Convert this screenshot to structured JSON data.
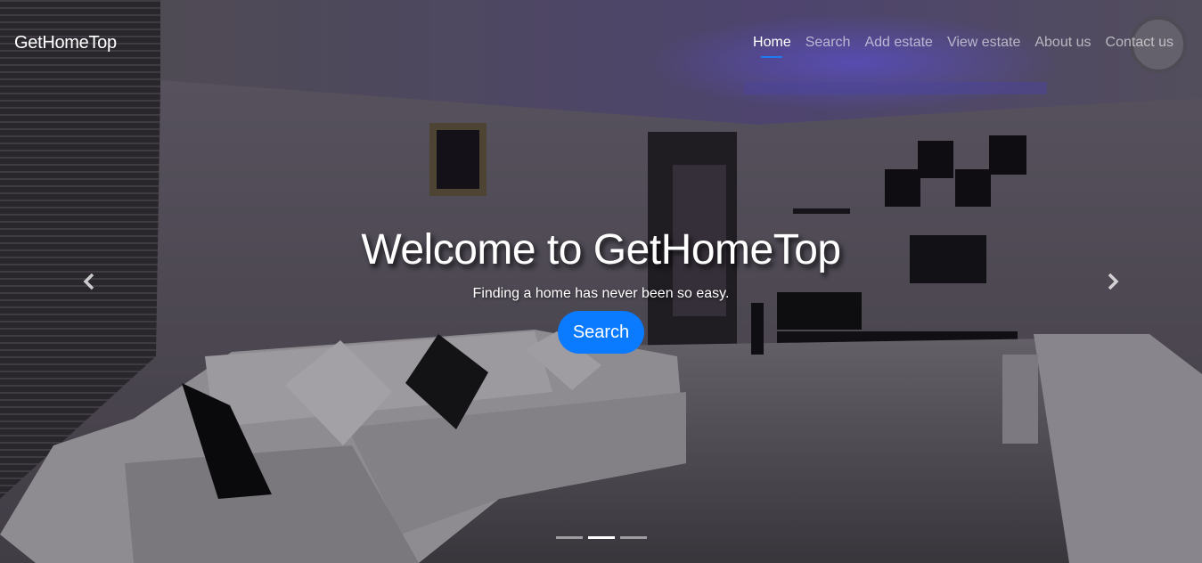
{
  "brand": "GetHomeTop",
  "nav": {
    "items": [
      {
        "label": "Home",
        "active": true
      },
      {
        "label": "Search",
        "active": false
      },
      {
        "label": "Add estate",
        "active": false
      },
      {
        "label": "View estate",
        "active": false
      },
      {
        "label": "About us",
        "active": false
      },
      {
        "label": "Contact us",
        "active": false
      }
    ]
  },
  "hero": {
    "headline": "Welcome to GetHomeTop",
    "subline": "Finding a home has never been so easy.",
    "cta_label": "Search",
    "background_image": "living-room-interior-photo"
  },
  "carousel": {
    "prev_icon": "chevron-left-icon",
    "next_icon": "chevron-right-icon",
    "slide_count": 3,
    "active_slide": 2
  },
  "colors": {
    "accent": "#0a7bff",
    "nav_underline": "#1e7bf2",
    "nav_inactive": "rgba(255,255,255,0.6)"
  }
}
